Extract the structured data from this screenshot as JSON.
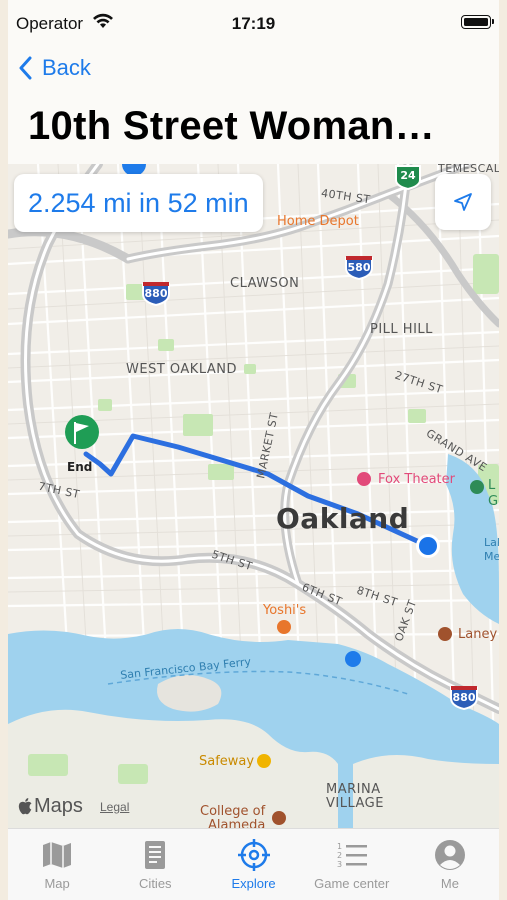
{
  "status_bar": {
    "carrier": "Operator",
    "time": "17:19"
  },
  "nav": {
    "back_label": "Back",
    "title": "10th Street Woman…"
  },
  "route": {
    "summary": "2.254 mi in 52 min"
  },
  "map": {
    "labels": {
      "oakland": "Oakland",
      "west_oakland": "WEST OAKLAND",
      "clawson": "CLAWSON",
      "pill_hill": "PILL HILL",
      "st27": "27TH ST",
      "st40": "40TH ST",
      "temescal": "TEMESCAL",
      "grand_ave": "GRAND AVE",
      "market_st": "MARKET ST",
      "st7": "7TH ST",
      "st5": "5TH ST",
      "st6": "6TH ST",
      "st8": "8TH ST",
      "oak_st": "OAK ST",
      "ferry": "San Francisco Bay Ferry",
      "marina": "MARINA",
      "village": "VILLAGE",
      "home_depot": "Home Depot",
      "fox_theater": "Fox Theater",
      "yoshis": "Yoshi's",
      "laney": "Laney",
      "safeway": "Safeway",
      "college1": "College of",
      "college2": "Alameda",
      "lake1": "Lak",
      "lake2": "Mer",
      "lg1": "L",
      "lg2": "G",
      "end": "End"
    },
    "shields": {
      "i880_a": "880",
      "i880_b": "880",
      "i580": "580",
      "ca24": "24"
    },
    "brand": "Maps",
    "legal": "Legal"
  },
  "tabs": [
    {
      "id": "map",
      "label": "Map",
      "icon": "map-icon",
      "active": false
    },
    {
      "id": "cities",
      "label": "Cities",
      "icon": "book-icon",
      "active": false
    },
    {
      "id": "explore",
      "label": "Explore",
      "icon": "crosshair-icon",
      "active": true
    },
    {
      "id": "game",
      "label": "Game center",
      "icon": "list-icon",
      "active": false
    },
    {
      "id": "me",
      "label": "Me",
      "icon": "person-icon",
      "active": false
    }
  ],
  "colors": {
    "accent": "#1e7bea",
    "route": "#2c6fe0",
    "water": "#9fd2ee",
    "park": "#c7e7b4",
    "highway": "#c9c9c9",
    "inactive_tab": "#9a9a9a"
  }
}
